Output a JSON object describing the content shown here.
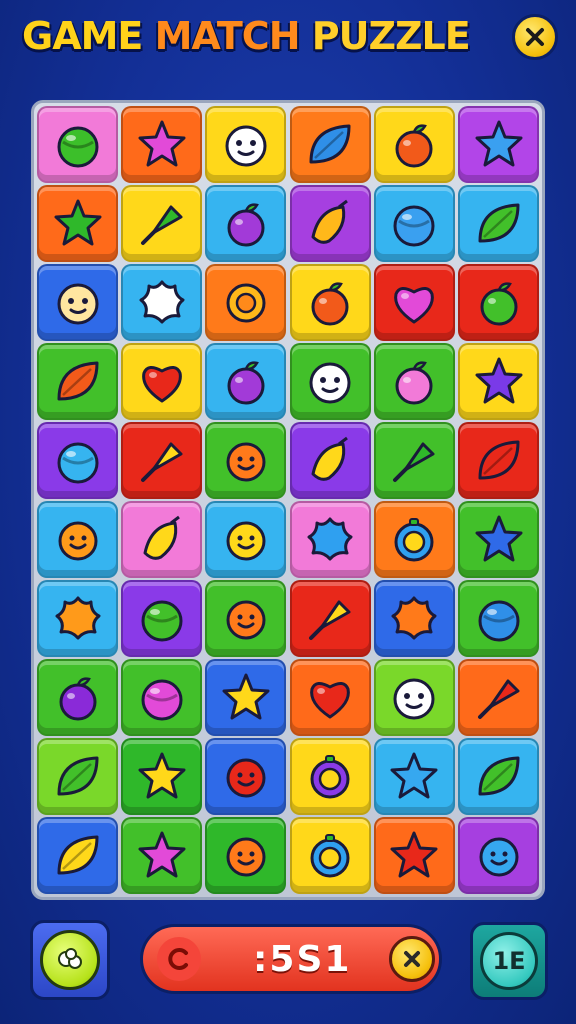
{
  "header": {
    "title_part1": "GAME",
    "title_part2": "MATCH",
    "title_part3": "PUZZLE",
    "close_icon": "close-icon"
  },
  "board": {
    "rows": 10,
    "cols": 6,
    "tiles": [
      [
        {
          "bg": "#f27ad8",
          "icon": "ball",
          "c": "#3cbf2a"
        },
        {
          "bg": "#ff6a1a",
          "icon": "star",
          "c": "#e24ad8"
        },
        {
          "bg": "#ffd81a",
          "icon": "face",
          "c": "#ffffff"
        },
        {
          "bg": "#ff7a1a",
          "icon": "leaf",
          "c": "#2f8fe8"
        },
        {
          "bg": "#ffd81a",
          "icon": "fruit",
          "c": "#f25a1a"
        },
        {
          "bg": "#b245e8",
          "icon": "star",
          "c": "#3aa0f0"
        }
      ],
      [
        {
          "bg": "#ff6a1a",
          "icon": "star",
          "c": "#2fb82a"
        },
        {
          "bg": "#ffd81a",
          "icon": "pin",
          "c": "#2fb82a"
        },
        {
          "bg": "#36b4f0",
          "icon": "fruit",
          "c": "#a23ad8"
        },
        {
          "bg": "#a63fe0",
          "icon": "bunch",
          "c": "#ffb81a"
        },
        {
          "bg": "#36b4f0",
          "icon": "ball",
          "c": "#3aa0f0"
        },
        {
          "bg": "#36b4f0",
          "icon": "leaf",
          "c": "#42c02a"
        }
      ],
      [
        {
          "bg": "#2f6ae8",
          "icon": "face",
          "c": "#ffe6a0"
        },
        {
          "bg": "#36b4f0",
          "icon": "splat",
          "c": "#ffffff"
        },
        {
          "bg": "#ff7a1a",
          "icon": "sun",
          "c": "#ffb81a"
        },
        {
          "bg": "#ffd81a",
          "icon": "fruit",
          "c": "#f25a1a"
        },
        {
          "bg": "#e8281a",
          "icon": "heart",
          "c": "#e24ad8"
        },
        {
          "bg": "#e8281a",
          "icon": "fruit",
          "c": "#42c02a"
        }
      ],
      [
        {
          "bg": "#42c02a",
          "icon": "leaf",
          "c": "#f25a1a"
        },
        {
          "bg": "#ffd81a",
          "icon": "heart",
          "c": "#e8281a"
        },
        {
          "bg": "#36b4f0",
          "icon": "fruit",
          "c": "#a23ad8"
        },
        {
          "bg": "#42c02a",
          "icon": "face",
          "c": "#ffffff"
        },
        {
          "bg": "#42c02a",
          "icon": "fruit",
          "c": "#f27ad8"
        },
        {
          "bg": "#ffd81a",
          "icon": "star",
          "c": "#7a3ae8"
        }
      ],
      [
        {
          "bg": "#8a3ae8",
          "icon": "ball",
          "c": "#36b4f0"
        },
        {
          "bg": "#e8281a",
          "icon": "pin",
          "c": "#ffd81a"
        },
        {
          "bg": "#42c02a",
          "icon": "smile",
          "c": "#ff7a1a"
        },
        {
          "bg": "#8a3ae8",
          "icon": "bunch",
          "c": "#ffd81a"
        },
        {
          "bg": "#42c02a",
          "icon": "pin",
          "c": "#2fb82a"
        },
        {
          "bg": "#e8281a",
          "icon": "leaf",
          "c": "#e8281a"
        }
      ],
      [
        {
          "bg": "#36b4f0",
          "icon": "smile",
          "c": "#ff9a1a"
        },
        {
          "bg": "#f27ad8",
          "icon": "bunch",
          "c": "#ffd81a"
        },
        {
          "bg": "#36b4f0",
          "icon": "smile",
          "c": "#ffd81a"
        },
        {
          "bg": "#f27ad8",
          "icon": "splat",
          "c": "#2fa0f0"
        },
        {
          "bg": "#ff7a1a",
          "icon": "ring",
          "c": "#2fa0f0"
        },
        {
          "bg": "#42c02a",
          "icon": "star",
          "c": "#2f6ae8"
        }
      ],
      [
        {
          "bg": "#36b4f0",
          "icon": "splat",
          "c": "#ff9a1a"
        },
        {
          "bg": "#8a3ae8",
          "icon": "ball",
          "c": "#42c02a"
        },
        {
          "bg": "#42c02a",
          "icon": "smile",
          "c": "#ff7a1a"
        },
        {
          "bg": "#e8281a",
          "icon": "pin",
          "c": "#ffd81a"
        },
        {
          "bg": "#2f6ae8",
          "icon": "splat",
          "c": "#ff7a1a"
        },
        {
          "bg": "#42c02a",
          "icon": "ball",
          "c": "#2f8fe8"
        }
      ],
      [
        {
          "bg": "#42c02a",
          "icon": "fruit",
          "c": "#8a2ad8"
        },
        {
          "bg": "#42c02a",
          "icon": "ball",
          "c": "#e24ad8"
        },
        {
          "bg": "#2f6ae8",
          "icon": "star",
          "c": "#ffd81a"
        },
        {
          "bg": "#ff6a1a",
          "icon": "heart",
          "c": "#e8281a"
        },
        {
          "bg": "#7ad82a",
          "icon": "face",
          "c": "#ffffff"
        },
        {
          "bg": "#ff6a1a",
          "icon": "pin",
          "c": "#e8281a"
        }
      ],
      [
        {
          "bg": "#7ad82a",
          "icon": "leaf",
          "c": "#42c02a"
        },
        {
          "bg": "#2fb82a",
          "icon": "star",
          "c": "#ffd81a"
        },
        {
          "bg": "#2f6ae8",
          "icon": "smile",
          "c": "#e8281a"
        },
        {
          "bg": "#ffd81a",
          "icon": "ring",
          "c": "#8a3ae8"
        },
        {
          "bg": "#36b4f0",
          "icon": "star",
          "c": "#36a8f0"
        },
        {
          "bg": "#36b4f0",
          "icon": "leaf",
          "c": "#42c02a"
        }
      ],
      [
        {
          "bg": "#2f6ae8",
          "icon": "leaf",
          "c": "#ffd81a"
        },
        {
          "bg": "#42c02a",
          "icon": "star",
          "c": "#e24ad8"
        },
        {
          "bg": "#2fb82a",
          "icon": "smile",
          "c": "#ff7a1a"
        },
        {
          "bg": "#ffd81a",
          "icon": "ring",
          "c": "#2fa0f0"
        },
        {
          "bg": "#ff6a1a",
          "icon": "star",
          "c": "#e8281a"
        },
        {
          "bg": "#a63fe0",
          "icon": "smile",
          "c": "#36a8f0"
        }
      ]
    ]
  },
  "bottom": {
    "hint_icon": "hint-icon",
    "score_icon": "restart-icon",
    "score_value": ":5S1",
    "score_close_icon": "close-icon",
    "level_value": "1E"
  }
}
